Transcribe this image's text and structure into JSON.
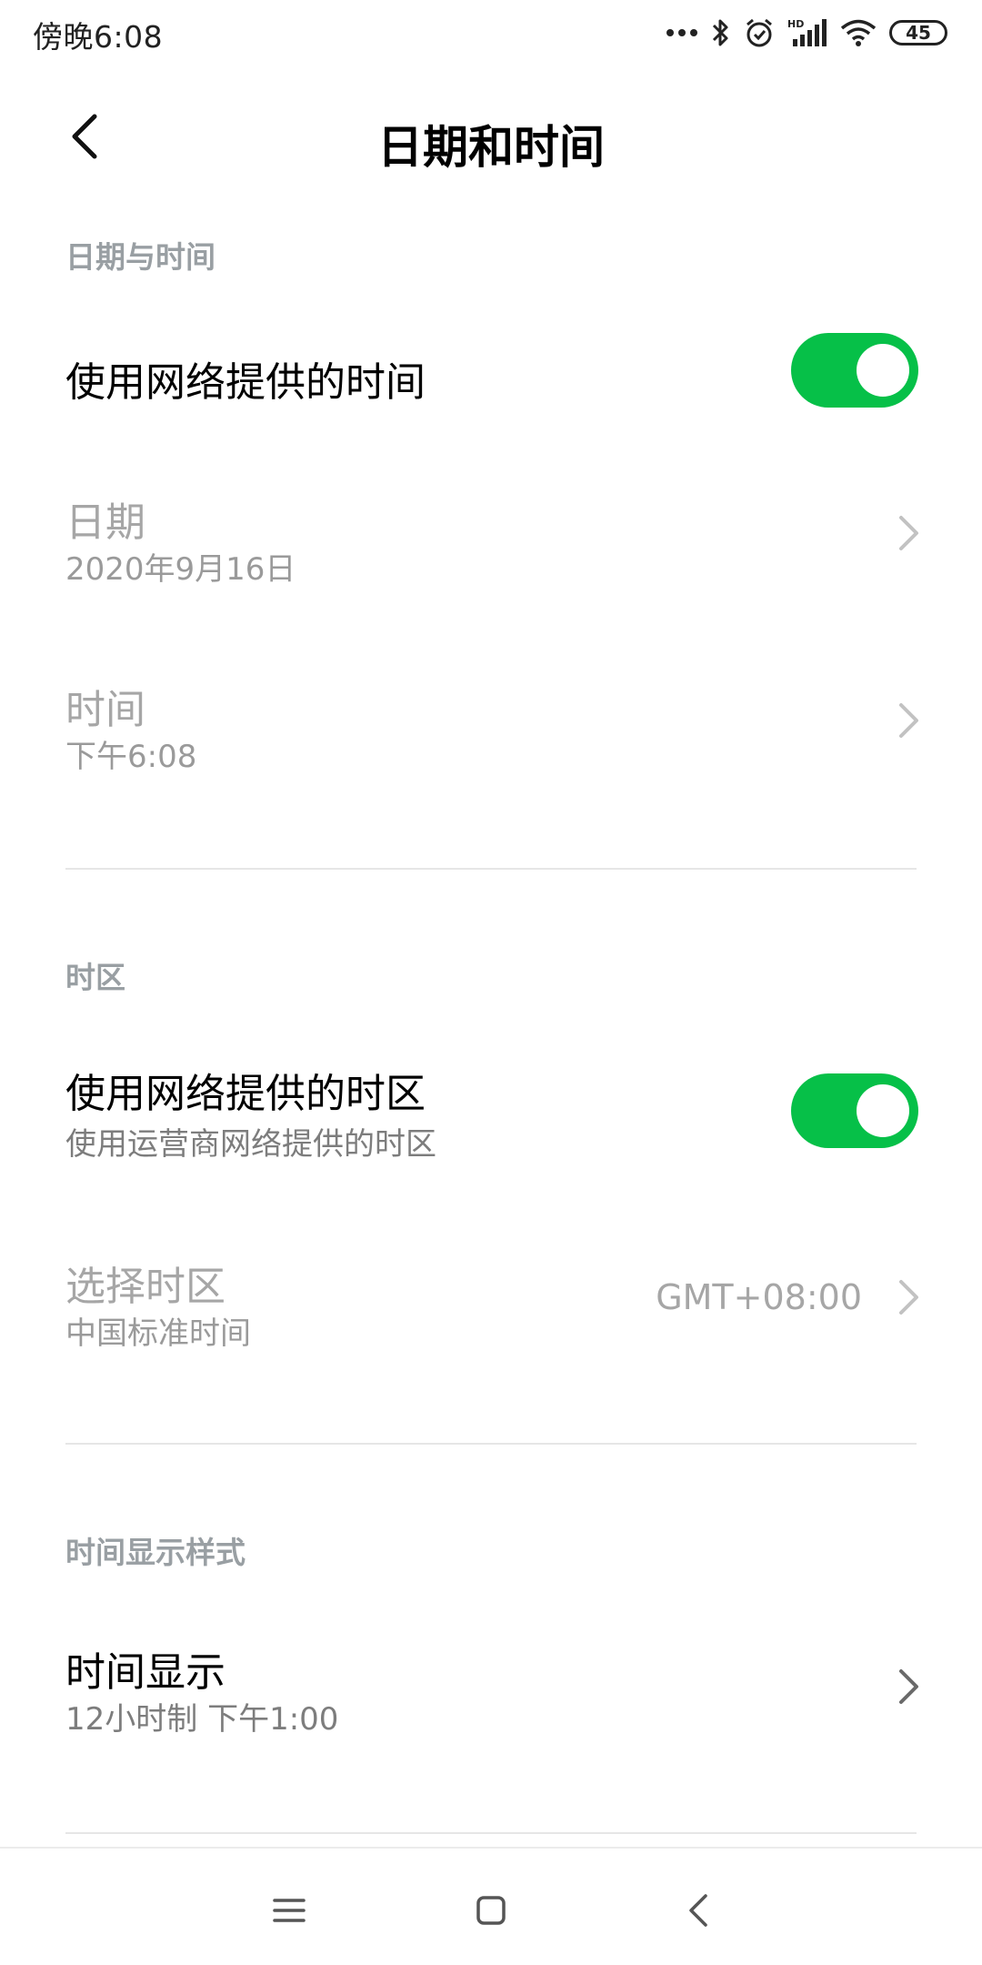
{
  "status_bar": {
    "time": "傍晚6:08",
    "battery": "45",
    "icons": [
      "more-dots-icon",
      "bluetooth-icon",
      "alarm-icon",
      "hd-signal-icon",
      "wifi-icon",
      "battery-icon"
    ]
  },
  "header": {
    "title": "日期和时间",
    "back_icon": "back-arrow-icon"
  },
  "section_date_time": {
    "header": "日期与时间",
    "network_time": {
      "title": "使用网络提供的时间",
      "enabled": true
    },
    "date": {
      "title": "日期",
      "value": "2020年9月16日"
    },
    "time": {
      "title": "时间",
      "value": "下午6:08"
    }
  },
  "section_timezone": {
    "header": "时区",
    "network_timezone": {
      "title": "使用网络提供的时区",
      "subtitle": "使用运营商网络提供的时区",
      "enabled": true
    },
    "select_timezone": {
      "title": "选择时区",
      "subtitle": "中国标准时间",
      "value": "GMT+08:00"
    }
  },
  "section_display": {
    "header": "时间显示样式",
    "time_format": {
      "title": "时间显示",
      "subtitle": "12小时制 下午1:00"
    }
  },
  "nav_bar": {
    "icons": [
      "menu-icon",
      "home-icon",
      "back-icon"
    ]
  },
  "colors": {
    "accent": "#06c048",
    "section_header": "#999fa3",
    "disabled_text": "#a6a6a6",
    "divider": "#e6e6e6"
  }
}
